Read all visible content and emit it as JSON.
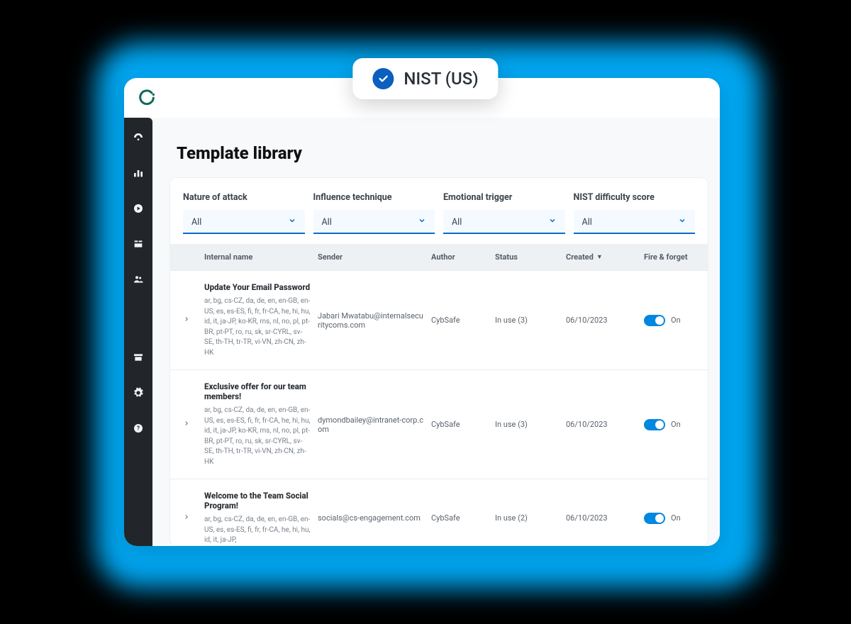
{
  "badge": {
    "label": "NIST (US)"
  },
  "page": {
    "title": "Template library"
  },
  "filters": [
    {
      "label": "Nature of attack",
      "value": "All"
    },
    {
      "label": "Influence technique",
      "value": "All"
    },
    {
      "label": "Emotional trigger",
      "value": "All"
    },
    {
      "label": "NIST difficulty score",
      "value": "All"
    }
  ],
  "columns": {
    "internal_name": "Internal name",
    "sender": "Sender",
    "author": "Author",
    "status": "Status",
    "created": "Created",
    "fire_forget": "Fire & forget"
  },
  "sort_indicator": "▼",
  "rows": [
    {
      "title": "Update Your Email Password",
      "langs": "ar, bg, cs-CZ, da, de, en, en-GB, en-US, es, es-ES, fi, fr, fr-CA, he, hi, hu, id, it, ja-JP, ko-KR, ms, nl, no, pl, pt-BR, pt-PT, ro, ru, sk, sr-CYRL, sv-SE, th-TH, tr-TR, vi-VN, zh-CN, zh-HK",
      "sender": "Jabari Mwatabu@internalsecuritycoms.com",
      "author": "CybSafe",
      "status": "In use (3)",
      "created": "06/10/2023",
      "toggle_label": "On"
    },
    {
      "title": "Exclusive offer for our team members!",
      "langs": "ar, bg, cs-CZ, da, de, en, en-GB, en-US, es, es-ES, fi, fr, fr-CA, he, hi, hu, id, it, ja-JP, ko-KR, ms, nl, no, pl, pt-BR, pt-PT, ro, ru, sk, sr-CYRL, sv-SE, th-TH, tr-TR, vi-VN, zh-CN, zh-HK",
      "sender": "dymondbailey@intranet-corp.com",
      "author": "CybSafe",
      "status": "In use (3)",
      "created": "06/10/2023",
      "toggle_label": "On"
    },
    {
      "title": "Welcome to the Team Social Program!",
      "langs": "ar, bg, cs-CZ, da, de, en, en-GB, en-US, es, es-ES, fi, fr, fr-CA, he, hi, hu, id, it, ja-JP,",
      "sender": "socials@cs-engagement.com",
      "author": "CybSafe",
      "status": "In use (2)",
      "created": "06/10/2023",
      "toggle_label": "On"
    }
  ],
  "sidebar_icons": [
    "dashboard",
    "reports",
    "play",
    "library",
    "groups",
    "archive",
    "settings",
    "help"
  ]
}
